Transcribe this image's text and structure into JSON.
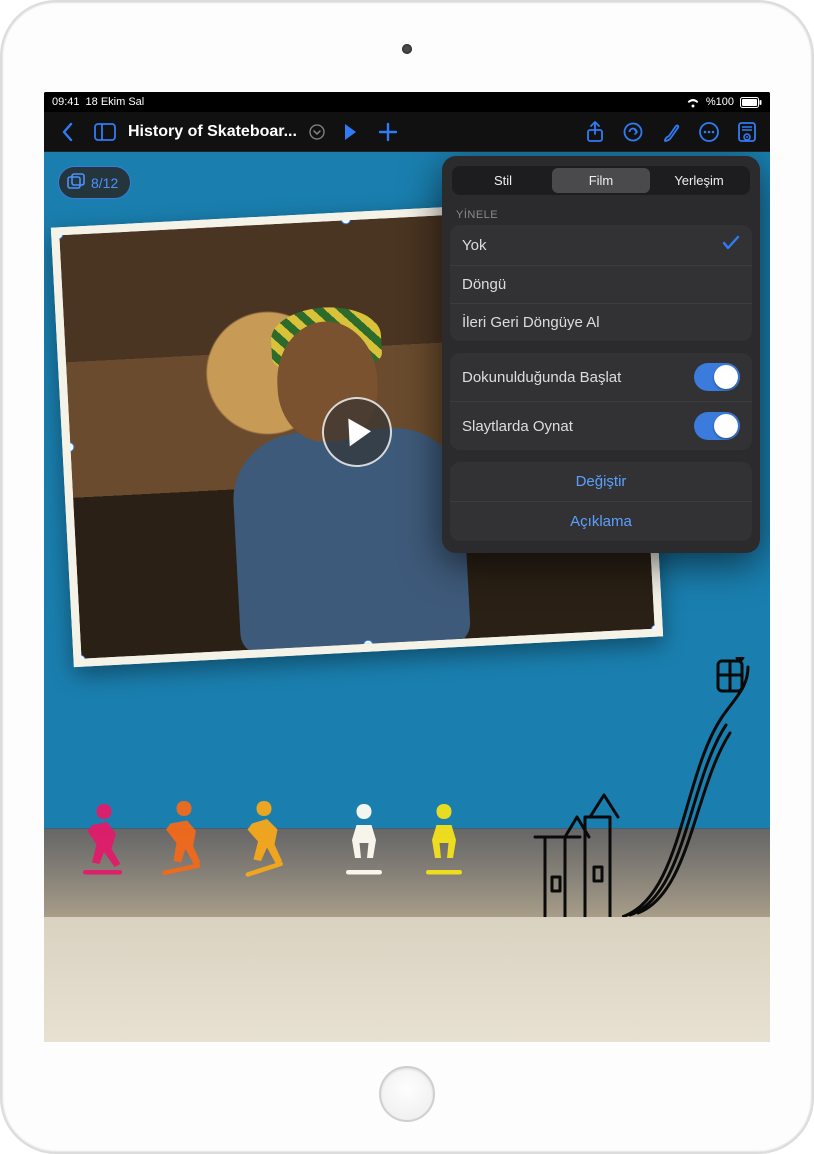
{
  "status": {
    "time": "09:41",
    "date": "18 Ekim Sal",
    "battery": "%100"
  },
  "toolbar": {
    "title": "History of Skateboar..."
  },
  "slide": {
    "counter": "8/12"
  },
  "popover": {
    "tabs": {
      "style": "Stil",
      "film": "Film",
      "layout": "Yerleşim"
    },
    "repeat_header": "YİNELE",
    "repeat_options": {
      "none": "Yok",
      "loop": "Döngü",
      "bounce": "İleri Geri Döngüye Al"
    },
    "start_on_tap": "Dokunulduğunda Başlat",
    "play_across_slides": "Slaytlarda Oynat",
    "replace": "Değiştir",
    "description": "Açıklama"
  }
}
